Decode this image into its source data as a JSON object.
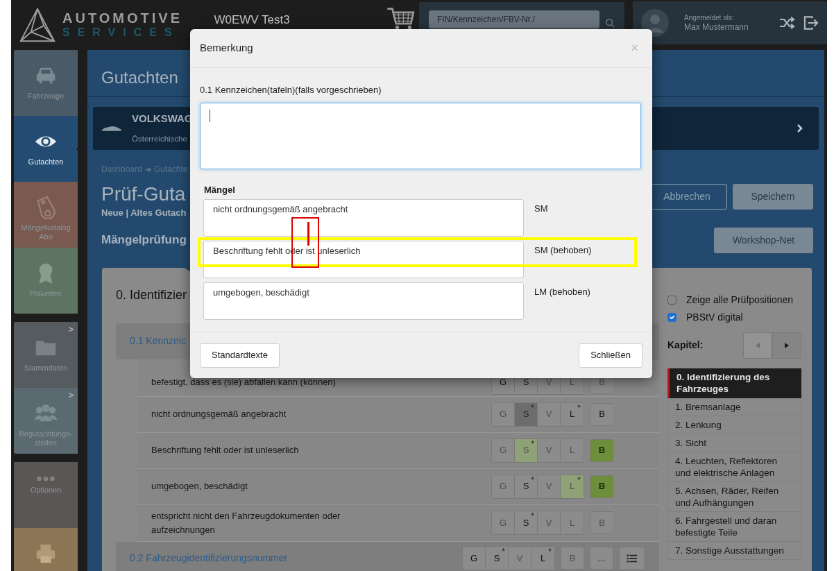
{
  "header": {
    "logo_title": "AUTOMOTIVE",
    "logo_subtitle": "SERVICES",
    "account": "W0EWV Test3",
    "search": {
      "placeholder": "FIN/Kennzeichen/FBV-Nr./"
    },
    "user": {
      "label": "Angemeldet als:",
      "name": "Max Mustermann"
    }
  },
  "sidebar": {
    "groups": [
      [
        {
          "label": "Fahrzeuge",
          "color": "#4a5a66",
          "selected": false
        },
        {
          "label": "Gutachten",
          "color": "#244c72",
          "selected": true
        },
        {
          "label": "Mängelkatalog Abo",
          "color": "#7a5a50",
          "selected": false
        },
        {
          "label": "Plaketten",
          "color": "#5f7363",
          "selected": false
        }
      ],
      [
        {
          "label": "Stammdaten",
          "color": "#565b60",
          "selected": false,
          "arrow": ">"
        },
        {
          "label": "Begutachtungs-stellen",
          "color": "#5a6a70",
          "selected": false,
          "arrow": ">"
        }
      ],
      [
        {
          "label": "Optionen",
          "color": "#5a5655",
          "selected": false
        },
        {
          "color": "#8b7555",
          "selected": false
        }
      ]
    ]
  },
  "page": {
    "section_title": "Gutachten",
    "vehicle": {
      "name": "VOLKSWAG",
      "subtitle": "Österreichische"
    },
    "breadcrumb": [
      "Dashboard",
      "Gutachte"
    ],
    "title": "Prüf-Guta",
    "subtitle": "Neue | Altes Gutach",
    "actions": [
      {
        "label": "Abbrechen",
        "kind": "outline"
      },
      {
        "label": "Speichern",
        "kind": "solid"
      }
    ],
    "subheading": "Mängelprüfung",
    "workshop_button": "Workshop-Net"
  },
  "checklist": {
    "chapter_heading": "0. Identifizier",
    "sections": [
      {
        "label": "0.1 Kennzeic",
        "items": [
          {
            "text": "befestigt, dass es (sie) abfallen kann (können)",
            "grades": [
              {
                "label": "G",
                "kind": "normal"
              },
              {
                "label": "S",
                "kind": "normal"
              },
              {
                "label": "V",
                "kind": "dim"
              },
              {
                "label": "L",
                "kind": "dim"
              },
              {
                "label": "B",
                "kind": "dim"
              }
            ]
          },
          {
            "text": "nicht ordnungsgemäß angebracht",
            "grades": [
              {
                "label": "G",
                "kind": "dim"
              },
              {
                "label": "S",
                "kind": "selected",
                "mark": "*"
              },
              {
                "label": "V",
                "kind": "dim"
              },
              {
                "label": "L",
                "kind": "normal",
                "mark": "*"
              },
              {
                "label": "B",
                "kind": "normal"
              }
            ]
          },
          {
            "text": "Beschriftung fehlt oder ist unleserlich",
            "grades": [
              {
                "label": "G",
                "kind": "dim"
              },
              {
                "label": "S",
                "kind": "light",
                "mark": "*"
              },
              {
                "label": "V",
                "kind": "dim"
              },
              {
                "label": "L",
                "kind": "dim"
              },
              {
                "label": "B",
                "kind": "green"
              }
            ]
          },
          {
            "text": "umgebogen, beschädigt",
            "grades": [
              {
                "label": "G",
                "kind": "dim"
              },
              {
                "label": "S",
                "kind": "normal",
                "mark": "*"
              },
              {
                "label": "V",
                "kind": "dim"
              },
              {
                "label": "L",
                "kind": "light",
                "mark": "*"
              },
              {
                "label": "B",
                "kind": "green"
              }
            ]
          },
          {
            "text": "entspricht nicht den Fahrzeugdokumenten oder aufzeichnungen",
            "grades": [
              {
                "label": "G",
                "kind": "dim"
              },
              {
                "label": "S",
                "kind": "normal",
                "mark": "*"
              },
              {
                "label": "V",
                "kind": "dim"
              },
              {
                "label": "L",
                "kind": "dim"
              },
              {
                "label": "B",
                "kind": "dim"
              }
            ]
          }
        ]
      },
      {
        "label": "0.2 Fahrzeugidentifizierungsnummer",
        "grades": [
          {
            "label": "G",
            "kind": "normal"
          },
          {
            "label": "S",
            "kind": "normal",
            "mark": "*"
          },
          {
            "label": "V",
            "kind": "dim"
          },
          {
            "label": "L",
            "kind": "normal",
            "mark": "*"
          },
          {
            "label": "B",
            "kind": "dim"
          }
        ],
        "more": "..."
      }
    ]
  },
  "options": [
    {
      "label": "Zeige alle Prüfpositionen",
      "checked": false
    },
    {
      "label": "PBStV digital",
      "checked": true
    }
  ],
  "chapters": {
    "label": "Kapitel:",
    "pager": [
      {
        "kind": "prev",
        "disabled": true
      },
      {
        "kind": "next",
        "disabled": false
      }
    ],
    "items": [
      {
        "label": "0. Identifizierung des Fahrzeuges",
        "selected": true
      },
      {
        "label": "1. Bremsanlage",
        "selected": false
      },
      {
        "label": "2. Lenkung",
        "selected": false
      },
      {
        "label": "3. Sicht",
        "selected": false
      },
      {
        "label": "4. Leuchten, Reflektoren und elektrische Anlagen",
        "selected": false
      },
      {
        "label": "5. Achsen, Räder, Reifen und Aufhängungen",
        "selected": false
      },
      {
        "label": "6. Fahrgestell und daran befestigte Teile",
        "selected": false
      },
      {
        "label": "7. Sonstige Ausstattungen",
        "selected": false
      }
    ]
  },
  "modal": {
    "title": "Bemerkung",
    "close": "×",
    "field_label": "0.1 Kennzeichen(tafeln)(falls vorgeschrieben)",
    "focused": true,
    "defects_label": "Mängel",
    "defects": [
      {
        "text": "nicht ordnungsgemäß angebracht",
        "type": "SM"
      },
      {
        "text": "Beschriftung fehlt oder ist unleserlich",
        "type": "SM (behoben)"
      },
      {
        "text": "umgebogen, beschädigt",
        "type": "LM (behoben)"
      }
    ],
    "buttons": [
      {
        "label": "Standardtexte"
      },
      {
        "label": "Schließen"
      }
    ]
  },
  "annotations": [
    {
      "kind": "frame",
      "color": "#ffff00"
    },
    {
      "kind": "cursor",
      "color": "#e00000"
    }
  ]
}
